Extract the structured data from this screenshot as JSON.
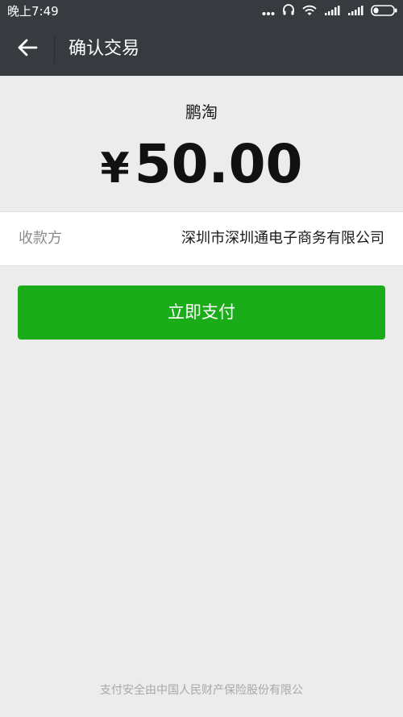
{
  "status_bar": {
    "time": "晚上7:49",
    "icons": [
      "more-dots-icon",
      "headset-icon",
      "wifi-icon",
      "signal-icon",
      "signal-icon",
      "battery-icon"
    ]
  },
  "header": {
    "title": "确认交易",
    "back_icon": "arrow-left-icon"
  },
  "payment": {
    "merchant": "鹏淘",
    "currency_symbol": "¥",
    "amount": "50.00"
  },
  "payee": {
    "label": "收款方",
    "value": "深圳市深圳通电子商务有限公司"
  },
  "actions": {
    "pay_label": "立即支付"
  },
  "footer": {
    "note": "支付安全由中国人民财产保险股份有限公"
  },
  "colors": {
    "header_bg": "#373a3f",
    "page_bg": "#ececec",
    "pay_button": "#1aad19"
  }
}
